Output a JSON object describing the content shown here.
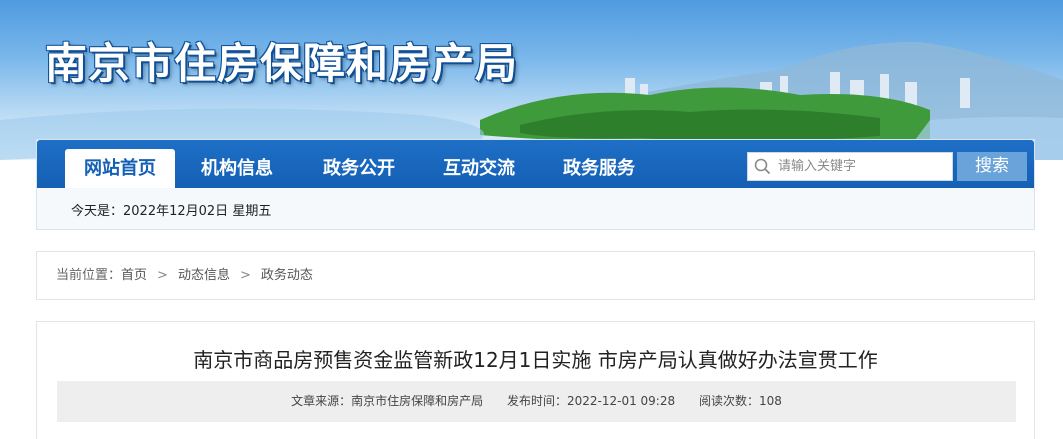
{
  "site": {
    "title": "南京市住房保障和房产局"
  },
  "nav": {
    "items": [
      {
        "label": "网站首页",
        "active": true
      },
      {
        "label": "机构信息",
        "active": false
      },
      {
        "label": "政务公开",
        "active": false
      },
      {
        "label": "互动交流",
        "active": false
      },
      {
        "label": "政务服务",
        "active": false
      }
    ],
    "search_placeholder": "请输入关键字",
    "search_button": "搜索"
  },
  "today": {
    "label": "今天是：",
    "date": "2022年12月02日",
    "weekday": "星期五"
  },
  "breadcrumb": {
    "prefix": "当前位置：",
    "items": [
      "首页",
      "动态信息",
      "政务动态"
    ]
  },
  "article": {
    "title": "南京市商品房预售资金监管新政12月1日实施 市房产局认真做好办法宣贯工作",
    "source_label": "文章来源：",
    "source": "南京市住房保障和房产局",
    "published_label": "发布时间：",
    "published": "2022-12-01 09:28",
    "views_label": "阅读次数：",
    "views": "108"
  },
  "colors": {
    "nav_blue": "#1460b5",
    "search_button": "#6aa3d9",
    "meta_bg": "#eeeeee"
  }
}
